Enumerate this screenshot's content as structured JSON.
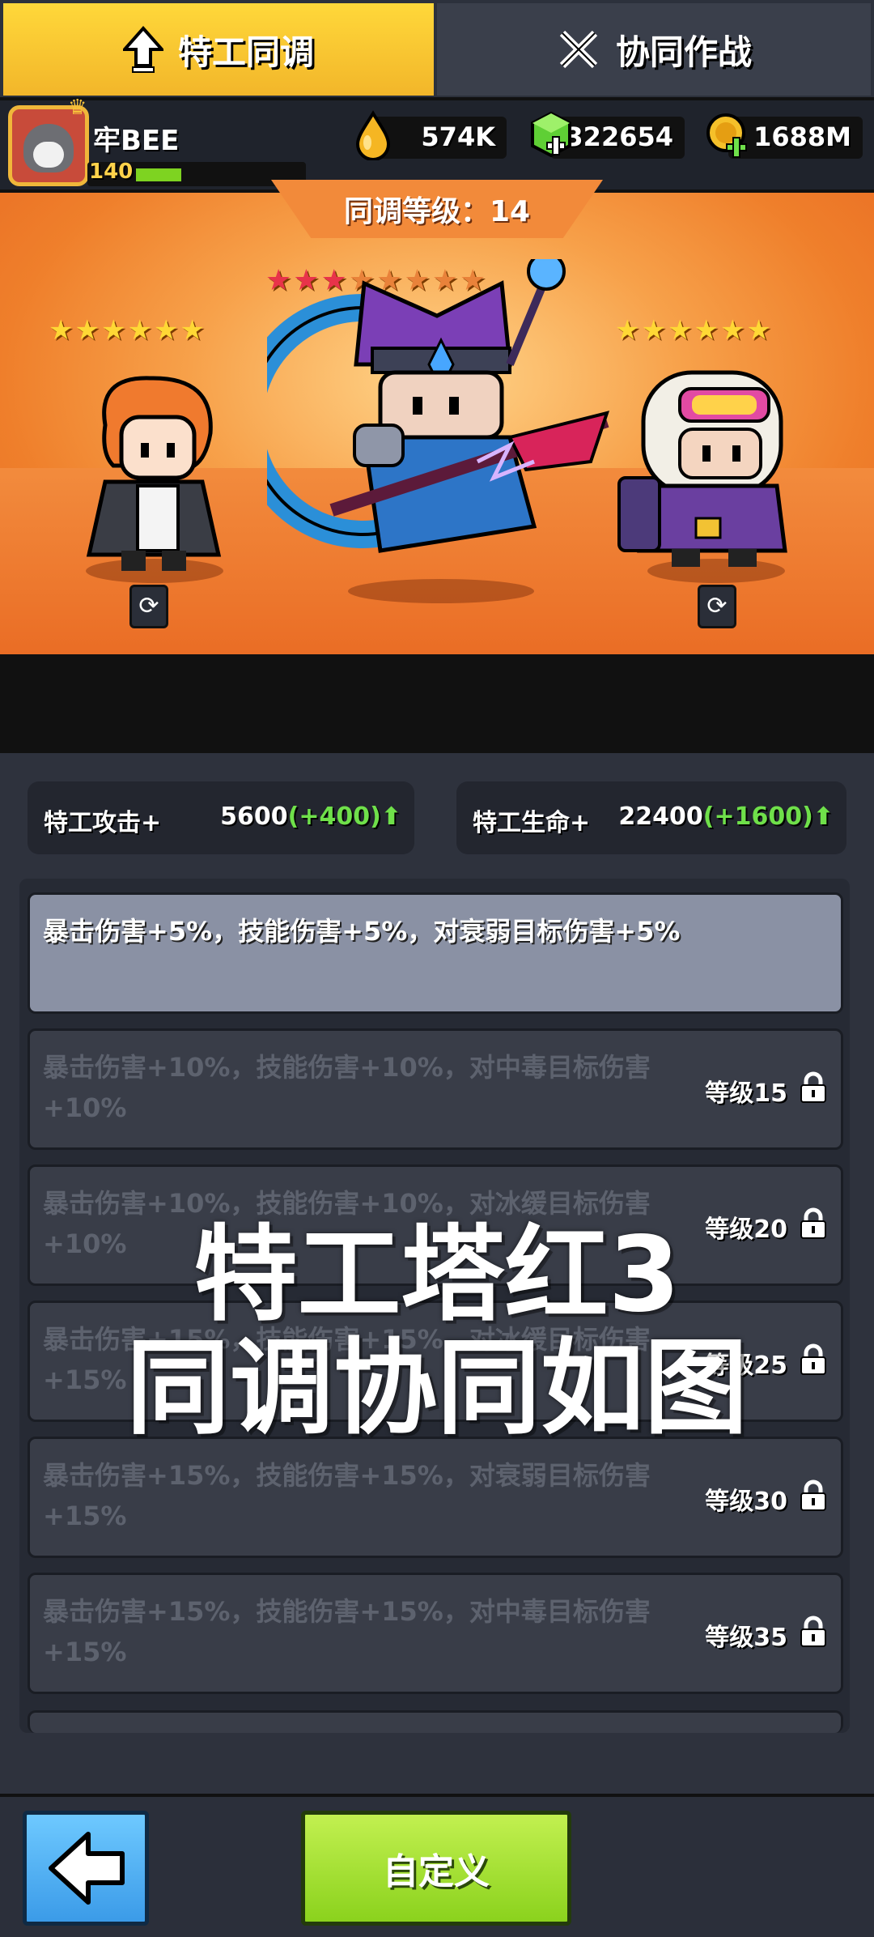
{
  "player": {
    "name": "牢BEE",
    "level": "140",
    "level_progress": 0.28
  },
  "currencies": {
    "gold": "574K",
    "gems": "322654",
    "coins": "1688M"
  },
  "sync": {
    "level_label": "同调等级：14",
    "main_stars": {
      "filled": 3,
      "total": 8
    },
    "left_stars": 6,
    "right_stars": 6
  },
  "tabs": {
    "active": "特工同调",
    "inactive": "协同作战"
  },
  "stats": {
    "attack": {
      "label": "特工攻击+",
      "value": "5600",
      "bonus": "(+400)"
    },
    "health": {
      "label": "特工生命+",
      "value": "22400",
      "bonus": "(+1600)"
    }
  },
  "perks": [
    {
      "text": "暴击伤害+5%，技能伤害+5%，对衰弱目标伤害+5%",
      "level": "",
      "locked": false
    },
    {
      "text": "暴击伤害+10%，技能伤害+10%，对中毒目标伤害+10%",
      "level": "等级15",
      "locked": true
    },
    {
      "text": "暴击伤害+10%，技能伤害+10%，对冰缓目标伤害+10%",
      "level": "等级20",
      "locked": true
    },
    {
      "text": "暴击伤害+15%，技能伤害+15%，对冰缓目标伤害+15%",
      "level": "等级25",
      "locked": true
    },
    {
      "text": "暴击伤害+15%，技能伤害+15%，对衰弱目标伤害+15%",
      "level": "等级30",
      "locked": true
    },
    {
      "text": "暴击伤害+15%，技能伤害+15%，对中毒目标伤害+15%",
      "level": "等级35",
      "locked": true
    }
  ],
  "overlay": {
    "line1": "特工塔红3",
    "line2": "同调协同如图"
  },
  "buttons": {
    "customize": "自定义"
  },
  "icons": {
    "avatar": "cat-avatar-icon",
    "gold": "gold-drop-icon",
    "gem": "green-gem-plus-icon",
    "coin": "gold-coin-plus-icon",
    "swap": "swap-icon",
    "lock": "lock-icon",
    "back": "back-arrow-icon",
    "tab_up": "up-arrow-icon",
    "tab_swords": "crossed-swords-icon"
  },
  "colors": {
    "accent_yellow": "#ffd83a",
    "stat_green": "#6fe04a",
    "button_green": "#8bd21d",
    "button_blue": "#3b9be8"
  }
}
